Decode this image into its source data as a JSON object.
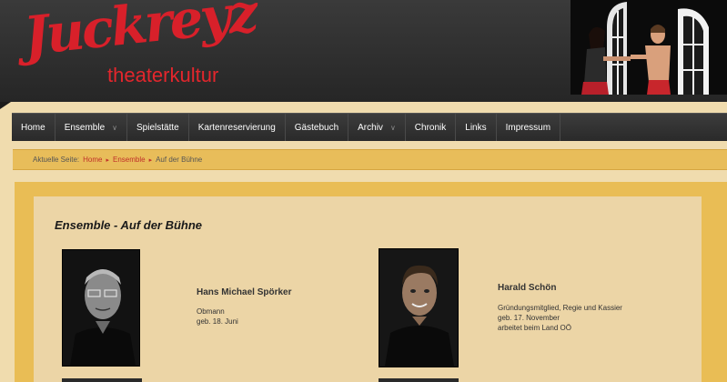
{
  "header": {
    "logo_script": "Juckreyz",
    "logo_subtitle": "theaterkultur"
  },
  "nav": {
    "items": [
      {
        "label": "Home",
        "has_dropdown": false
      },
      {
        "label": "Ensemble",
        "has_dropdown": true
      },
      {
        "label": "Spielstätte",
        "has_dropdown": false
      },
      {
        "label": "Kartenreservierung",
        "has_dropdown": false
      },
      {
        "label": "Gästebuch",
        "has_dropdown": false
      },
      {
        "label": "Archiv",
        "has_dropdown": true
      },
      {
        "label": "Chronik",
        "has_dropdown": false
      },
      {
        "label": "Links",
        "has_dropdown": false
      },
      {
        "label": "Impressum",
        "has_dropdown": false
      }
    ],
    "dropdown_glyph": "∨"
  },
  "breadcrumb": {
    "prefix": "Aktuelle Seite:",
    "home": "Home",
    "ensemble": "Ensemble",
    "current": "Auf der Bühne",
    "separator": "▸"
  },
  "main": {
    "title": "Ensemble - Auf der Bühne",
    "members": [
      {
        "name": "Hans Michael Spörker",
        "lines": [
          "Obmann",
          "geb. 18. Juni"
        ]
      },
      {
        "name": "Harald Schön",
        "lines": [
          "Gründungsmitglied, Regie und Kassier",
          "geb. 17. November",
          "arbeitet beim Land OÖ"
        ]
      }
    ]
  },
  "colors": {
    "header_bg": "#2f2f2f",
    "logo_red": "#d8202a",
    "page_bg": "#f0dcae",
    "breadcrumb_bg": "#e8bd5a",
    "content_frame": "#e9bd55",
    "content_bg": "#ecd5a6",
    "link_red": "#c0302a"
  }
}
